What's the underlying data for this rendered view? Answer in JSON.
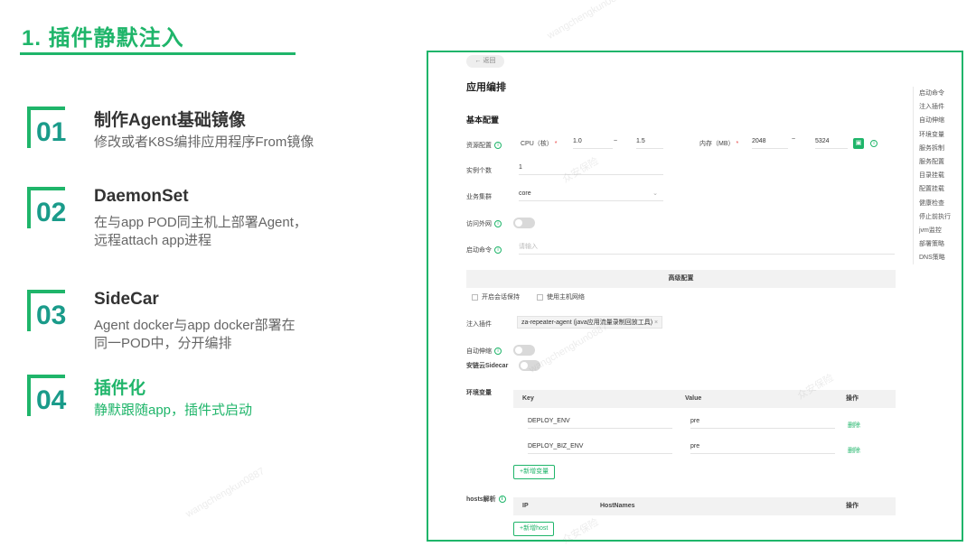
{
  "slide": {
    "title": "1. 插件静默注入",
    "steps": [
      {
        "num": "01",
        "head": "制作Agent基础镜像",
        "desc": "修改或者K8S编排应用程序From镜像"
      },
      {
        "num": "02",
        "head": "DaemonSet",
        "desc": "在与app POD同主机上部署Agent，远程attach app进程"
      },
      {
        "num": "03",
        "head": "SideCar",
        "desc": "Agent docker与app docker部署在同一POD中，分开编排"
      },
      {
        "num": "04",
        "head": "插件化",
        "desc": "静默跟随app，插件式启动"
      }
    ],
    "accent": "#1fb56a",
    "num_color": "#1a9b8a"
  },
  "app": {
    "back_label": "← 返回",
    "page_title": "应用编排",
    "basic_section": "基本配置",
    "resource": {
      "label": "资源配置",
      "cpu_label": "CPU（核）",
      "cpu_min": "1.0",
      "cpu_sep": "~",
      "cpu_max": "1.5",
      "mem_label": "内存（MB）",
      "mem_min": "2048",
      "mem_sep": "~",
      "mem_max": "5324",
      "save_icon": "save-icon"
    },
    "instances": {
      "label": "实例个数",
      "value": "1"
    },
    "cluster": {
      "label": "业务集群",
      "value": "core"
    },
    "external": {
      "label": "访问外网"
    },
    "startup_cmd": {
      "label": "启动命令",
      "placeholder": "请输入"
    },
    "advanced": {
      "title": "高级配置",
      "opt_keepalive": "开启会话保持",
      "opt_hostnet": "使用主机网络"
    },
    "plugin": {
      "label": "注入插件",
      "tag": "za-repeater-agent (java应用流量录制回放工具)",
      "tag_close": "×"
    },
    "autoscale": {
      "label": "自动伸缩"
    },
    "sidecar": {
      "label": "安链云Sidecar"
    },
    "env": {
      "label": "环境变量",
      "col_key": "Key",
      "col_value": "Value",
      "col_op": "操作",
      "rows": [
        {
          "key": "DEPLOY_ENV",
          "value": "pre",
          "op": "删除"
        },
        {
          "key": "DEPLOY_BIZ_ENV",
          "value": "pre",
          "op": "删除"
        }
      ],
      "add_label": "+新增变量"
    },
    "hosts": {
      "label": "hosts解析",
      "col_ip": "IP",
      "col_names": "HostNames",
      "col_op": "操作",
      "add_label": "+新增host"
    },
    "anchor_nav": [
      "启动命令",
      "注入插件",
      "自动伸缩",
      "环境变量",
      "服务拆制",
      "服务配置",
      "目录挂载",
      "配置挂载",
      "健康检查",
      "停止前执行",
      "jvm监控",
      "部署策略",
      "DNS策略"
    ]
  },
  "watermark": {
    "text_a": "众安保险",
    "text_b": "wangchengkun0887"
  }
}
